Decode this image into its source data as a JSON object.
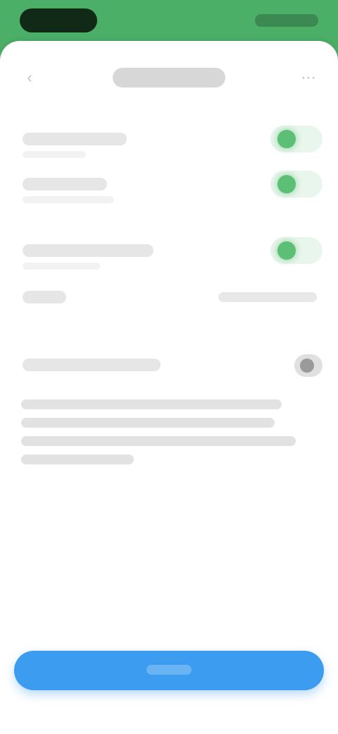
{
  "status_bar": {
    "time": "",
    "indicators": ""
  },
  "header": {
    "title": "",
    "back_icon": "chevron-left-icon",
    "menu_icon": "more-icon"
  },
  "settings": {
    "rows": [
      {
        "label": "",
        "subtext": "",
        "control": "toggle",
        "state": "on"
      },
      {
        "label": "",
        "subtext": "",
        "control": "toggle",
        "state": "on"
      },
      {
        "label": "",
        "subtext": "",
        "control": "toggle",
        "state": "on"
      },
      {
        "label": "",
        "value": "",
        "control": "value"
      }
    ],
    "secondary_row": {
      "label": "",
      "control": "switch",
      "state": "off"
    },
    "description": ""
  },
  "cta": {
    "label": ""
  },
  "colors": {
    "status_bar_green": "#4caf67",
    "toggle_green": "#5bbf76",
    "button_blue": "#3b9cf0",
    "background": "#ffffff"
  }
}
